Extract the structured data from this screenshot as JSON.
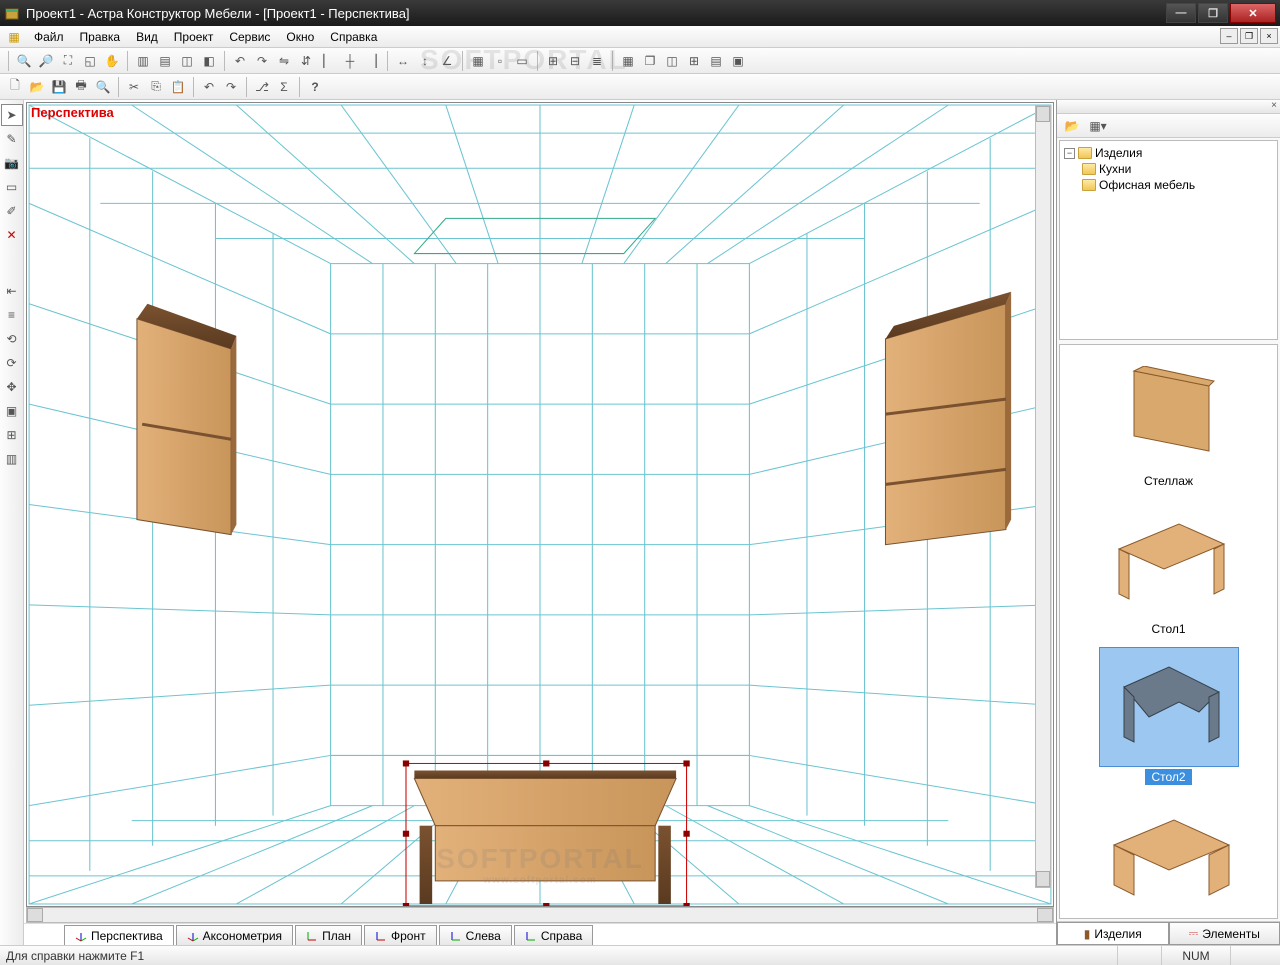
{
  "window": {
    "title": "Проект1 - Астра Конструктор Мебели - [Проект1 - Перспектива]"
  },
  "menu": {
    "items": [
      "Файл",
      "Правка",
      "Вид",
      "Проект",
      "Сервис",
      "Окно",
      "Справка"
    ]
  },
  "view": {
    "label": "Перспектива"
  },
  "viewTabs": [
    {
      "label": "Перспектива",
      "active": true,
      "axis": "xyz"
    },
    {
      "label": "Аксонометрия",
      "active": false,
      "axis": "xyz"
    },
    {
      "label": "План",
      "active": false,
      "axis": "xy"
    },
    {
      "label": "Фронт",
      "active": false,
      "axis": "xz"
    },
    {
      "label": "Слева",
      "active": false,
      "axis": "yz"
    },
    {
      "label": "Справа",
      "active": false,
      "axis": "yz"
    }
  ],
  "tree": {
    "root": "Изделия",
    "children": [
      "Кухни",
      "Офисная мебель"
    ]
  },
  "catalog": [
    {
      "label": "Стеллаж",
      "selected": false,
      "shape": "shelf"
    },
    {
      "label": "Стол1",
      "selected": false,
      "shape": "desk1"
    },
    {
      "label": "Стол2",
      "selected": true,
      "shape": "desk2"
    },
    {
      "label": "",
      "selected": false,
      "shape": "desk3"
    }
  ],
  "sideTabs": [
    {
      "label": "Изделия",
      "active": true
    },
    {
      "label": "Элементы",
      "active": false
    }
  ],
  "status": {
    "hint": "Для справки нажмите F1",
    "num": "NUM"
  },
  "watermark": {
    "line1": "SOFTPORTAL",
    "line2": "www.softportal.com"
  }
}
